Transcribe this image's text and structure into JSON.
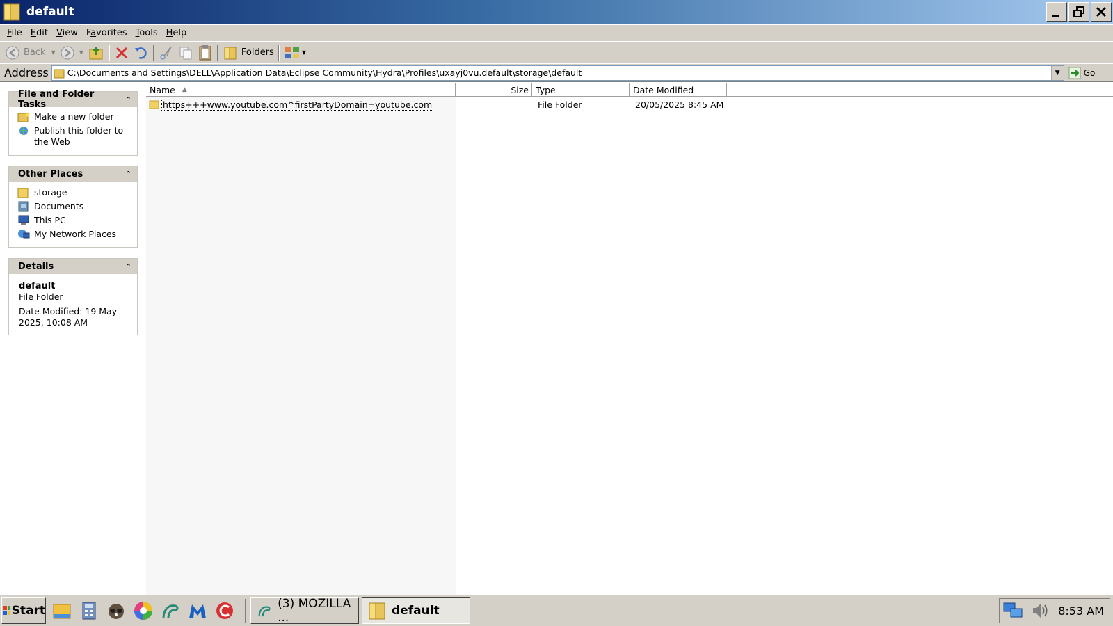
{
  "window": {
    "title": "default"
  },
  "menu": [
    "File",
    "Edit",
    "View",
    "Favorites",
    "Tools",
    "Help"
  ],
  "menu_underline": [
    "F",
    "E",
    "V",
    "a",
    "T",
    "H"
  ],
  "toolbar": {
    "back_label": "Back",
    "folders_label": "Folders"
  },
  "address": {
    "label": "Address",
    "path": "C:\\Documents and Settings\\DELL\\Application Data\\Eclipse Community\\Hydra\\Profiles\\uxayj0vu.default\\storage\\default",
    "go_label": "Go"
  },
  "tasks_panel": {
    "title": "File and Folder Tasks",
    "items": [
      {
        "label": "Make a new folder",
        "icon": "new-folder-icon"
      },
      {
        "label": "Publish this folder to the Web",
        "icon": "publish-web-icon"
      }
    ]
  },
  "places_panel": {
    "title": "Other Places",
    "items": [
      {
        "label": "storage",
        "icon": "folder-icon"
      },
      {
        "label": "Documents",
        "icon": "documents-icon"
      },
      {
        "label": "This PC",
        "icon": "computer-icon"
      },
      {
        "label": "My Network Places",
        "icon": "network-icon"
      }
    ]
  },
  "details_panel": {
    "title": "Details",
    "name": "default",
    "type": "File Folder",
    "modified_line1": "Date Modified: 19 May",
    "modified_line2": "2025, 10:08 AM"
  },
  "columns": {
    "name": "Name",
    "size": "Size",
    "type": "Type",
    "date": "Date Modified"
  },
  "files": [
    {
      "name": "https+++www.youtube.com^firstPartyDomain=youtube.com",
      "size": "",
      "type": "File Folder",
      "date": "20/05/2025 8:45 AM"
    }
  ],
  "taskbar": {
    "start_label": "Start",
    "tasks": [
      {
        "label": "(3) MOZILLA ...",
        "active": false
      },
      {
        "label": "default",
        "active": true
      }
    ],
    "clock": "8:53 AM"
  },
  "colors": {
    "title_start": "#0a246a",
    "title_end": "#a6caf0",
    "chrome": "#d4d0c8"
  }
}
